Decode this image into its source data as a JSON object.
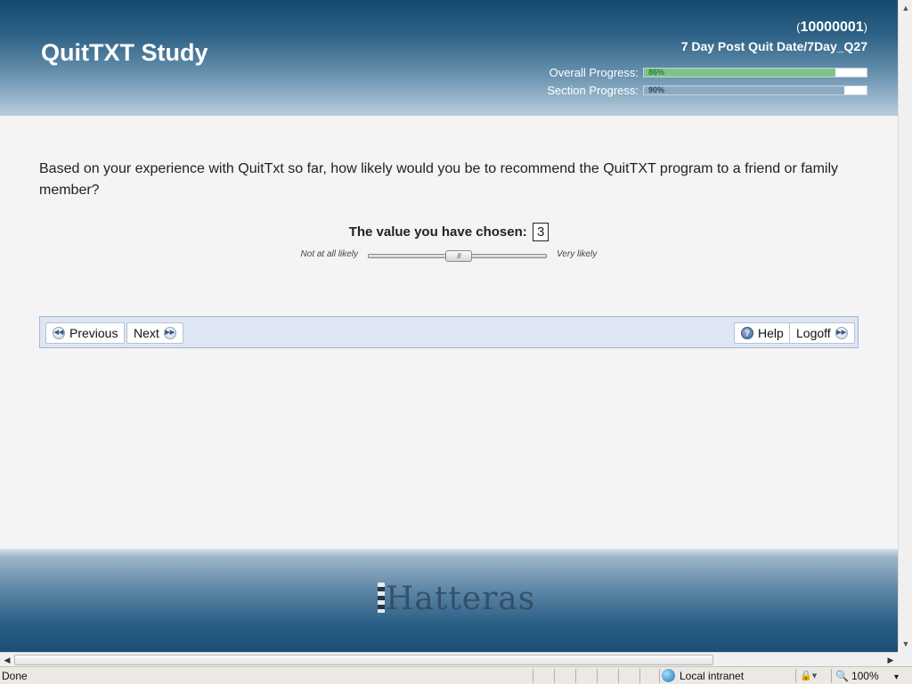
{
  "header": {
    "title": "QuitTXT Study",
    "participant_id": "10000001",
    "question_name": "7 Day Post Quit Date/7Day_Q27",
    "overall_progress": {
      "label": "Overall Progress:",
      "percent": 86,
      "text": "86%"
    },
    "section_progress": {
      "label": "Section Progress:",
      "percent": 90,
      "text": "90%"
    }
  },
  "question": {
    "text": "Based on your experience with QuitTxt so far, how likely would you be to recommend the QuitTXT program to a friend or family member?",
    "chosen_label": "The value you have chosen:",
    "chosen_value": "3",
    "slider": {
      "low_label": "Not at all likely",
      "high_label": "Very likely",
      "min": 1,
      "max": 5,
      "value": 3,
      "grip": "///"
    }
  },
  "nav": {
    "previous": "Previous",
    "next": "Next",
    "help": "Help",
    "logoff": "Logoff"
  },
  "footer": {
    "logo_text": "Hatteras"
  },
  "statusbar": {
    "status": "Done",
    "zone": "Local intranet",
    "zoom": "100%",
    "zoom_arrow": "▾",
    "protected_icon": "🔒▾"
  },
  "colors": {
    "overall_fill": "#7cc48a",
    "section_fill": "#8aaac4",
    "header_dark": "#16496f"
  }
}
